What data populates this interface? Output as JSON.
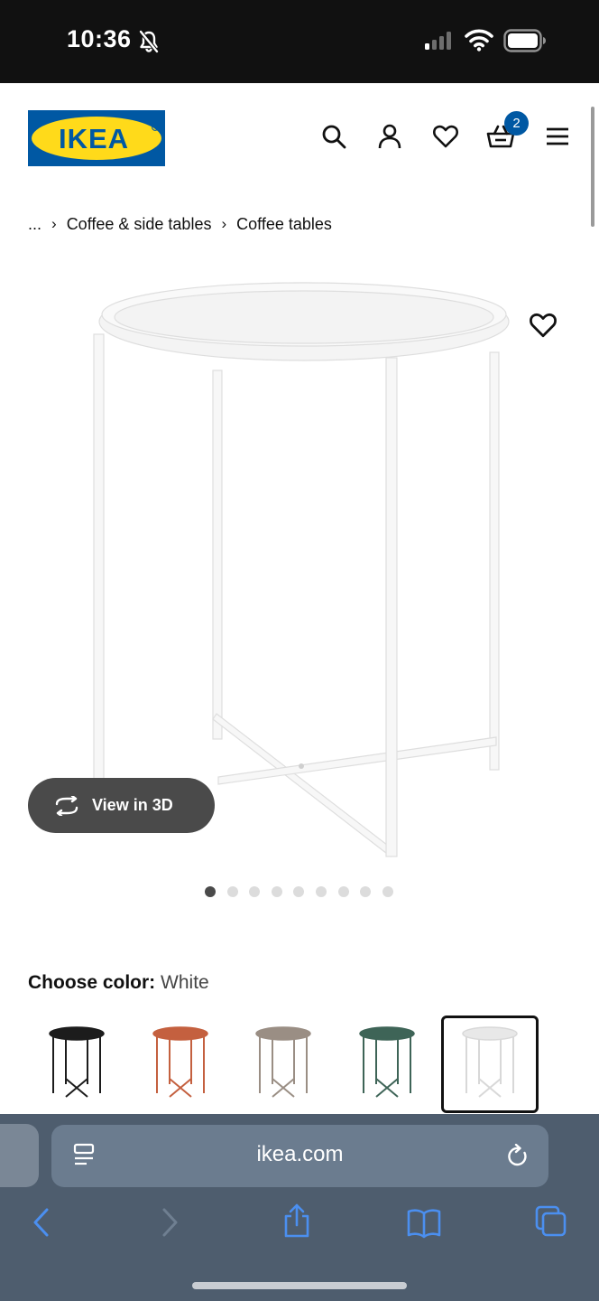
{
  "status_bar": {
    "time": "10:36"
  },
  "header": {
    "logo_text": "IKEA",
    "cart_count": "2",
    "brand_colors": {
      "blue": "#0058a3",
      "yellow": "#ffda1a"
    },
    "icons": [
      "search-icon",
      "account-icon",
      "heart-icon",
      "cart-icon",
      "menu-icon"
    ]
  },
  "breadcrumb": {
    "ellipsis": "...",
    "items": [
      "Coffee & side tables",
      "Coffee tables"
    ]
  },
  "product": {
    "view_3d_label": "View in 3D",
    "image_count": 9,
    "active_image_index": 0
  },
  "color_chooser": {
    "label": "Choose color:",
    "selected": "White",
    "options": [
      {
        "color": "#1c1c1c"
      },
      {
        "color": "#c4603f"
      },
      {
        "color": "#9a8e84"
      },
      {
        "color": "#3e6457"
      },
      {
        "color": "#e8e8e8"
      }
    ],
    "selected_index": 4
  },
  "browser": {
    "url": "ikea.com",
    "accent": "#4b8ff0"
  }
}
